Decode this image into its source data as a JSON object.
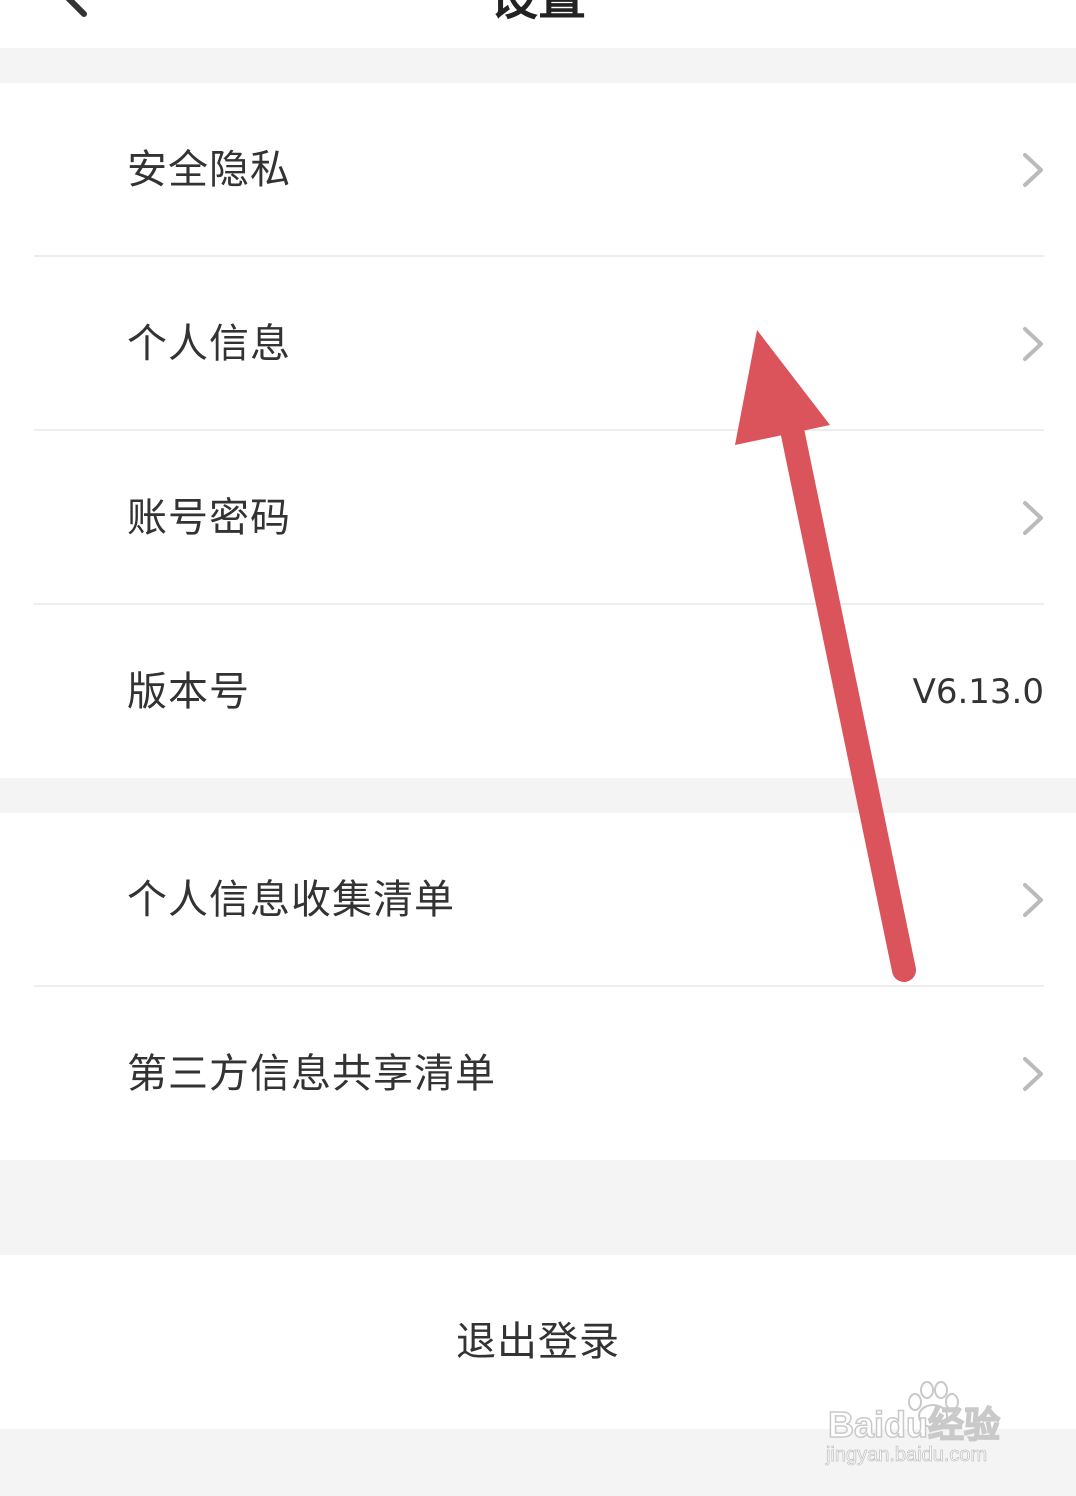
{
  "header": {
    "title": "设置",
    "back_icon": "chevron-left-icon"
  },
  "settings_group_1": {
    "items": [
      {
        "label": "安全隐私",
        "icon": "chevron-right-icon"
      },
      {
        "label": "个人信息",
        "icon": "chevron-right-icon"
      },
      {
        "label": "账号密码",
        "icon": "chevron-right-icon"
      },
      {
        "label": "版本号",
        "value": "V6.13.0"
      }
    ]
  },
  "settings_group_2": {
    "items": [
      {
        "label": "个人信息收集清单",
        "icon": "chevron-right-icon"
      },
      {
        "label": "第三方信息共享清单",
        "icon": "chevron-right-icon"
      }
    ]
  },
  "logout": {
    "label": "退出登录"
  },
  "annotation": {
    "color": "#db535b",
    "type": "arrow"
  },
  "watermark": {
    "brand": "Baidu经验",
    "url": "jingyan.baidu.com"
  },
  "colors": {
    "background": "#f4f4f4",
    "panel": "#ffffff",
    "text": "#333333",
    "chevron": "#bbbbbb",
    "divider": "#eeeeee"
  }
}
